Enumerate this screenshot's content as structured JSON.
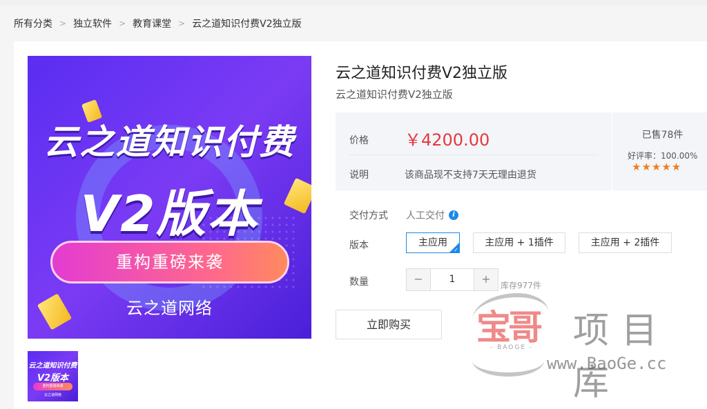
{
  "breadcrumb": {
    "items": [
      "所有分类",
      "独立软件",
      "教育课堂",
      "云之道知识付费V2独立版"
    ]
  },
  "product": {
    "title": "云之道知识付费V2独立版",
    "subtitle": "云之道知识付费V2独立版",
    "image_text": {
      "line1": "云之道知识付费",
      "line2": "V2版本",
      "pill": "重构重磅来袭",
      "brand": "云之道网络"
    }
  },
  "price_box": {
    "price_label": "价格",
    "price": "￥4200.00",
    "note_label": "说明",
    "note": "该商品现不支持7天无理由退货",
    "sold": "已售78件",
    "rating": "好评率：100.00%",
    "stars": "★★★★★",
    "rating_value": 5
  },
  "options": {
    "delivery_label": "交付方式",
    "delivery_value": "人工交付",
    "info_icon": "i",
    "version_label": "版本",
    "versions": [
      "主应用",
      "主应用 + 1插件",
      "主应用 + 2插件"
    ],
    "selected_version": "主应用",
    "selected_mark": "✓",
    "quantity_label": "数量",
    "quantity_minus": "−",
    "quantity": "1",
    "quantity_plus": "+",
    "stock": "库存977件"
  },
  "buy_button": "立即购买",
  "watermark": {
    "brand_cn": "宝哥",
    "brand_cn2": "项目库",
    "brand_en": "- BAOGE -",
    "url": "www.BaoGe.cc"
  },
  "colors": {
    "price_red": "#e4393c",
    "accent_blue": "#1e88e5",
    "star_orange": "#f37b1d"
  }
}
